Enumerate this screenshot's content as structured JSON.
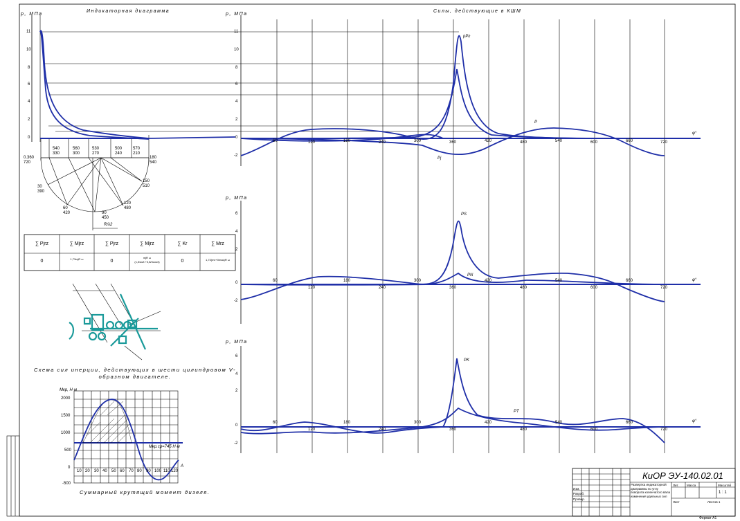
{
  "indicator": {
    "title": "Индикаторная диаграмма",
    "ylabel": "p, МПа",
    "yticks": [
      "11",
      "10",
      "8",
      "6",
      "4",
      "2",
      "0"
    ],
    "angles_top": [
      "540\n330",
      "560\n300",
      "530\n270",
      "500\n240",
      "570\n210"
    ],
    "angles_left": [
      "0.360\n720",
      "30\n390",
      "60\n420",
      "90\n450",
      "120\n480",
      "150\n510",
      "180\n540"
    ],
    "radius_label": "R/λ2"
  },
  "forces_chart": {
    "title": "Силы, действующие в КШМ",
    "ylabel": "p, МПа",
    "yticks": [
      "11",
      "10",
      "8",
      "6",
      "4",
      "2",
      "0",
      "-2"
    ],
    "xticks": [
      "60",
      "120",
      "180",
      "240",
      "300",
      "360",
      "420",
      "480",
      "540",
      "600",
      "660",
      "720"
    ],
    "xlabel": "φ°",
    "labels": {
      "pg": "pPг",
      "p": "P",
      "pj": "Pj"
    }
  },
  "chart2": {
    "ylabel": "p, МПа",
    "yticks": [
      "6",
      "4",
      "2",
      "0",
      "-2"
    ],
    "xticks": [
      "60",
      "120",
      "180",
      "240",
      "300",
      "360",
      "420",
      "480",
      "540",
      "600",
      "660",
      "720"
    ],
    "xlabel": "φ°",
    "labels": {
      "ps": "PS",
      "pn": "PN"
    }
  },
  "chart3": {
    "ylabel": "p, МПа",
    "yticks": [
      "6",
      "4",
      "2",
      "0",
      "-2"
    ],
    "xticks": [
      "60",
      "120",
      "180",
      "240",
      "300",
      "360",
      "420",
      "480",
      "540",
      "600",
      "660",
      "720"
    ],
    "xlabel": "φ°",
    "labels": {
      "pk": "PK",
      "pt": "PT"
    }
  },
  "balance_table": {
    "headers": [
      "∑ Pjrz",
      "∑ Mjrz",
      "∑ Pjrz",
      "∑ Mjrz",
      "∑ Kr",
      "∑ Mrz"
    ],
    "values": [
      "0",
      "1,73mjR ω",
      "0",
      "mjR ω\n(1,5sw3 +0,8/3cos3)",
      "0",
      "1,73(mv+0mas)R ω"
    ]
  },
  "scheme": {
    "title": "Схема сил инерции, действующих в шести цилиндровом V-образном двигателе."
  },
  "torque": {
    "ylabel": "Мкр, Н·м",
    "yticks": [
      "2000",
      "1500",
      "1000",
      "500",
      "0",
      "-500"
    ],
    "xticks": [
      "10",
      "20",
      "30",
      "40",
      "50",
      "60",
      "70",
      "80",
      "90",
      "100",
      "110",
      "120"
    ],
    "mean_label": "Мкр.ср=745 Н·м",
    "end_label": "A",
    "title": "Суммарный крутящий момент дизеля."
  },
  "stamp": {
    "doc_code": "КиОР ЭУ-140.02.01",
    "description": "Развертка индикаторной диаграммы по углу поворота коленчатого вала изменения удельных сил",
    "rows": [
      "Изм.",
      "Разраб.",
      "Провер."
    ],
    "col_heads": [
      "Лит.",
      "Масса",
      "Масштаб"
    ],
    "scale": "1 : 1",
    "sheet": "Лист",
    "sheets": "Листов 1",
    "format": "Формат А1"
  },
  "colors": {
    "curve": "#1f2fa8",
    "scheme": "#1a9a9a",
    "line": "#000000"
  }
}
